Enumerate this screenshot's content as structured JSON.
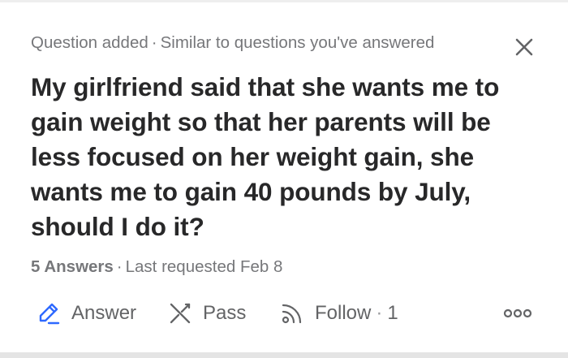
{
  "header": {
    "status": "Question added",
    "separator": "·",
    "reason": "Similar to questions you've answered",
    "close_icon": "close-icon"
  },
  "question": {
    "title": "My girlfriend said that she wants me to gain weight so that her parents will be less focused on her weight gain, she wants me to gain 40 pounds by July, should I do it?"
  },
  "stats": {
    "answers": "5 Answers",
    "separator": "·",
    "requested": "Last requested Feb 8"
  },
  "actions": {
    "answer": {
      "label": "Answer",
      "icon": "pencil-icon"
    },
    "pass": {
      "label": "Pass",
      "icon": "pass-icon"
    },
    "follow": {
      "label": "Follow",
      "separator": "·",
      "count": "1",
      "icon": "follow-icon"
    },
    "more_icon": "more-icon"
  },
  "colors": {
    "accent": "#2e69ff",
    "text": "#282829",
    "muted": "#76777a",
    "icon": "#636466"
  }
}
